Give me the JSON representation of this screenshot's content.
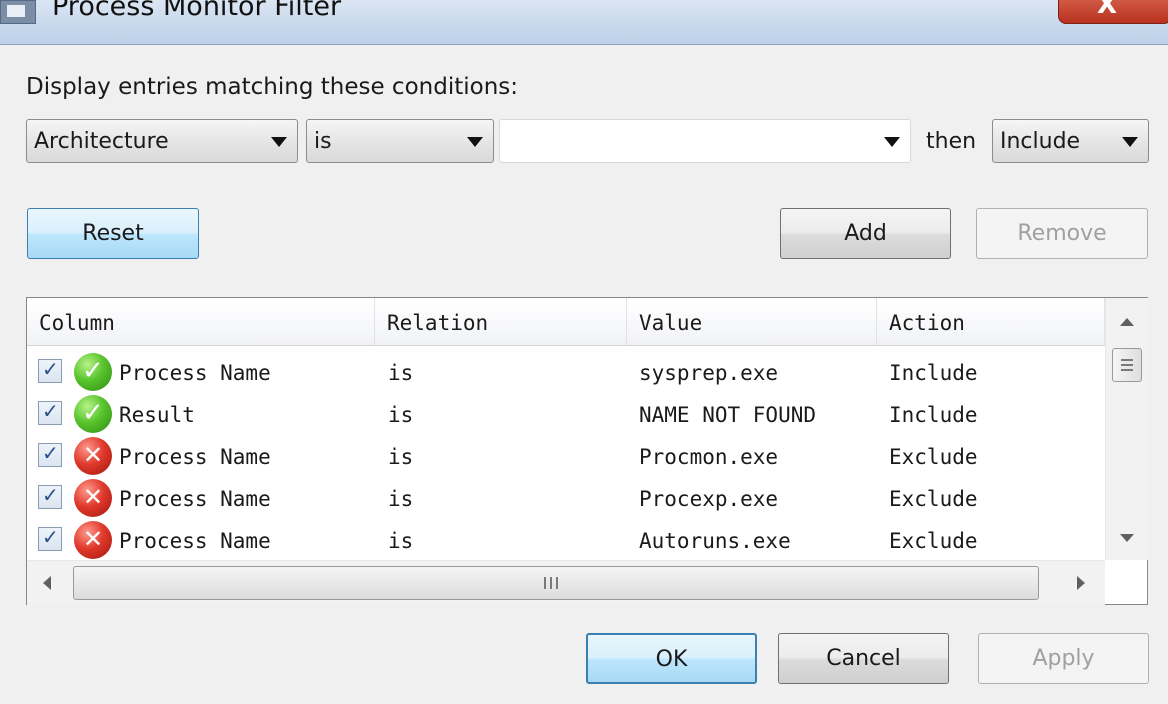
{
  "window": {
    "title": "Process Monitor Filter",
    "close_glyph": "X"
  },
  "prompt": "Display entries matching these conditions:",
  "condition": {
    "column": "Architecture",
    "relation": "is",
    "value": "",
    "then_label": "then",
    "action": "Include"
  },
  "buttons": {
    "reset": "Reset",
    "add": "Add",
    "remove": "Remove",
    "ok": "OK",
    "cancel": "Cancel",
    "apply": "Apply"
  },
  "table": {
    "headers": [
      "Column",
      "Relation",
      "Value",
      "Action"
    ],
    "rows": [
      {
        "checked": true,
        "status": "include",
        "status_icon": "green-check-icon",
        "column": "Process Name",
        "relation": "is",
        "value": "sysprep.exe",
        "action": "Include"
      },
      {
        "checked": true,
        "status": "include",
        "status_icon": "green-check-icon",
        "column": "Result",
        "relation": "is",
        "value": "NAME NOT FOUND",
        "action": "Include"
      },
      {
        "checked": true,
        "status": "exclude",
        "status_icon": "red-x-icon",
        "column": "Process Name",
        "relation": "is",
        "value": "Procmon.exe",
        "action": "Exclude"
      },
      {
        "checked": true,
        "status": "exclude",
        "status_icon": "red-x-icon",
        "column": "Process Name",
        "relation": "is",
        "value": "Procexp.exe",
        "action": "Exclude"
      },
      {
        "checked": true,
        "status": "exclude",
        "status_icon": "red-x-icon",
        "column": "Process Name",
        "relation": "is",
        "value": "Autoruns.exe",
        "action": "Exclude"
      }
    ]
  },
  "colors": {
    "titlebar": "#c7d8ec",
    "close_button": "#c8432f",
    "focused_button": "#bee6fd",
    "include_icon": "#3aa81e",
    "exclude_icon": "#d02a1e"
  }
}
